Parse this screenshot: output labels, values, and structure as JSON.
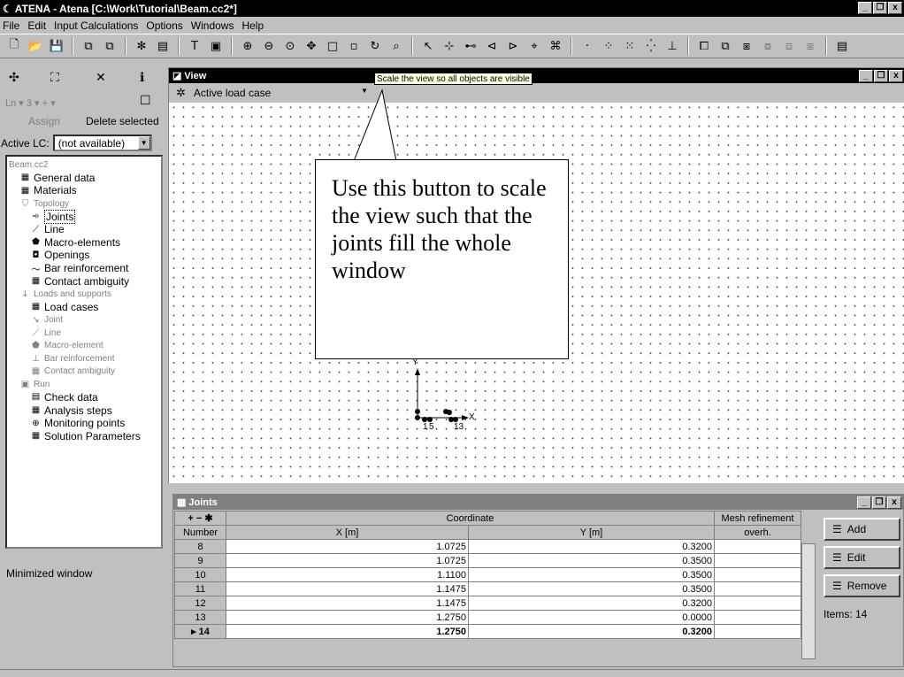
{
  "window": {
    "title": "ATENA - Atena [C:\\Work\\Tutorial\\Beam.cc2*]",
    "minimize": "_",
    "restore": "❐",
    "close": "x"
  },
  "menu": [
    "File",
    "Edit",
    "Input Calculations",
    "Options",
    "Windows",
    "Help"
  ],
  "left_panel": {
    "assign": "Assign",
    "delete_selected": "Delete selected",
    "active_lc_label": "Active LC:",
    "active_lc_value": "(not available)",
    "tree": [
      {
        "label": "Beam.cc2",
        "icon": "",
        "level": 0,
        "dim": true
      },
      {
        "label": "General data",
        "icon": "table-icon",
        "level": 1
      },
      {
        "label": "Materials",
        "icon": "table-icon",
        "level": 1
      },
      {
        "label": "Topology",
        "icon": "shield-icon",
        "level": 1,
        "dim": true
      },
      {
        "label": "Joints",
        "icon": "joint-icon",
        "level": 2,
        "selected": true
      },
      {
        "label": "Line",
        "icon": "line-icon",
        "level": 2
      },
      {
        "label": "Macro-elements",
        "icon": "macro-icon",
        "level": 2
      },
      {
        "label": "Openings",
        "icon": "opening-icon",
        "level": 2
      },
      {
        "label": "Bar reinforcement",
        "icon": "bar-icon",
        "level": 2
      },
      {
        "label": "Contact ambiguity",
        "icon": "table-icon",
        "level": 2
      },
      {
        "label": "Loads and supports",
        "icon": "arrow-down-icon",
        "level": 1,
        "dim": true
      },
      {
        "label": "Load cases",
        "icon": "table-icon",
        "level": 2
      },
      {
        "label": "Joint",
        "icon": "joint-load-icon",
        "level": 2,
        "dim": true
      },
      {
        "label": "Line",
        "icon": "line-load-icon",
        "level": 2,
        "dim": true
      },
      {
        "label": "Macro-element",
        "icon": "macro-icon",
        "level": 2,
        "dim": true
      },
      {
        "label": "Bar reinforcement",
        "icon": "support-icon",
        "level": 2,
        "dim": true
      },
      {
        "label": "Contact ambiguity",
        "icon": "table-icon",
        "level": 2,
        "dim": true
      },
      {
        "label": "Run",
        "icon": "run-icon",
        "level": 1,
        "dim": true
      },
      {
        "label": "Check data",
        "icon": "check-icon",
        "level": 2
      },
      {
        "label": "Analysis steps",
        "icon": "table-icon",
        "level": 2
      },
      {
        "label": "Monitoring points",
        "icon": "crosshair-icon",
        "level": 2
      },
      {
        "label": "Solution Parameters",
        "icon": "table-icon",
        "level": 2
      }
    ],
    "minimized_window": "Minimized window"
  },
  "view": {
    "title": "View",
    "load_case": "Active load case",
    "tooltip": "Scale the view so all objects are visible",
    "callout": "Use this button to scale the view such that the joints fill the whole window",
    "axis_y": "Y",
    "axis_x": "X",
    "node_labels": [
      "1",
      "5",
      "13"
    ]
  },
  "joints": {
    "title": "Joints",
    "col_number": "Number",
    "col_coordinate": "Coordinate",
    "col_x": "X [m]",
    "col_y": "Y [m]",
    "col_mesh": "Mesh refinement",
    "col_mesh2": "overh.",
    "rows": [
      {
        "n": "8",
        "x": "1.0725",
        "y": "0.3200"
      },
      {
        "n": "9",
        "x": "1.0725",
        "y": "0.3500"
      },
      {
        "n": "10",
        "x": "1.1100",
        "y": "0.3500"
      },
      {
        "n": "11",
        "x": "1.1475",
        "y": "0.3500"
      },
      {
        "n": "12",
        "x": "1.1475",
        "y": "0.3200"
      },
      {
        "n": "13",
        "x": "1.2750",
        "y": "0.0000"
      },
      {
        "n": "14",
        "x": "1.2750",
        "y": "0.3200",
        "current": true
      }
    ],
    "add": "Add",
    "edit": "Edit",
    "remove": "Remove",
    "items": "Items: 14"
  }
}
